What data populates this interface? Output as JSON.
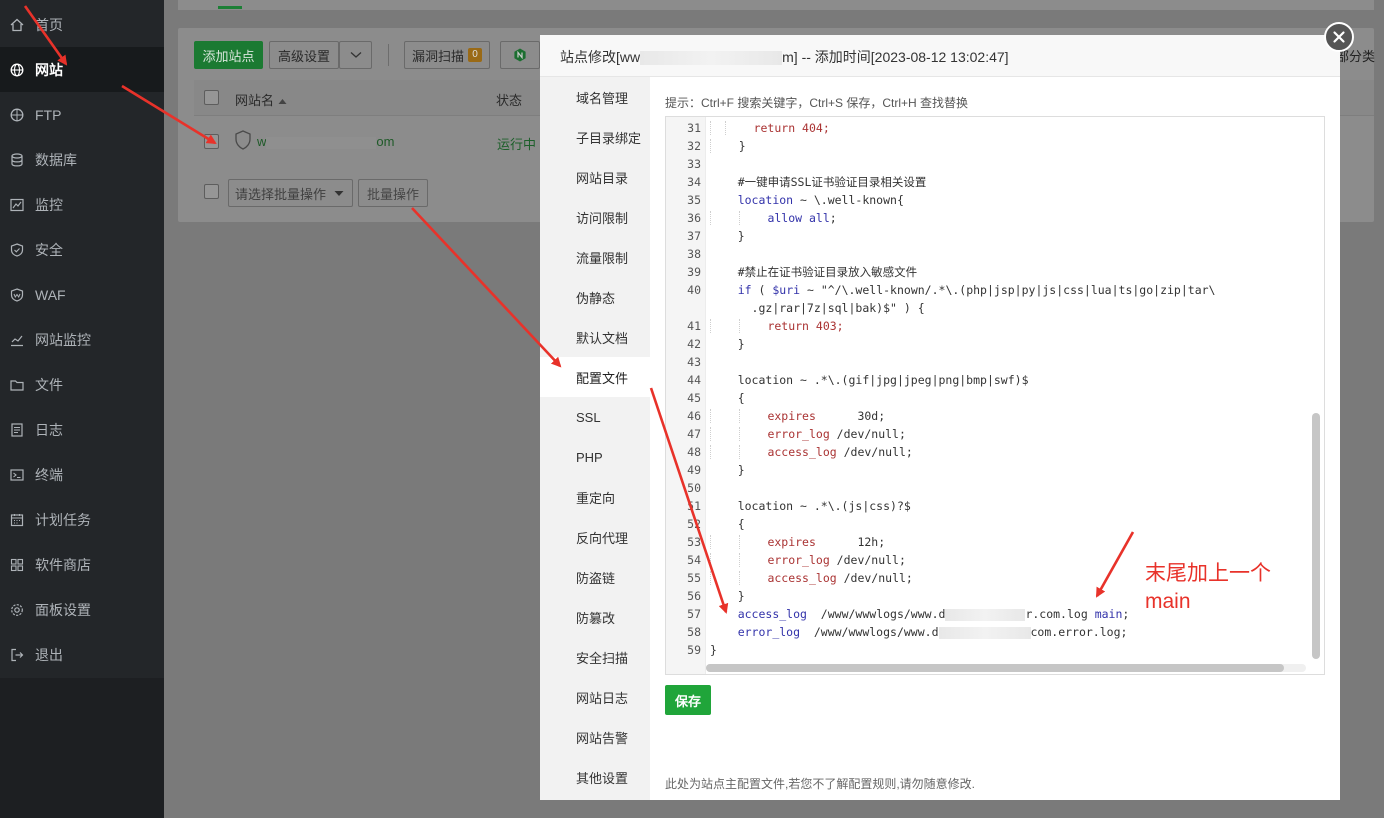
{
  "sidebar": {
    "items": [
      {
        "label": "首页",
        "icon": "home-icon"
      },
      {
        "label": "网站",
        "icon": "globe-icon",
        "active": true
      },
      {
        "label": "FTP",
        "icon": "ftp-icon"
      },
      {
        "label": "数据库",
        "icon": "database-icon"
      },
      {
        "label": "监控",
        "icon": "monitor-icon"
      },
      {
        "label": "安全",
        "icon": "shield-icon"
      },
      {
        "label": "WAF",
        "icon": "waf-icon"
      },
      {
        "label": "网站监控",
        "icon": "chart-icon"
      },
      {
        "label": "文件",
        "icon": "folder-icon"
      },
      {
        "label": "日志",
        "icon": "log-icon"
      },
      {
        "label": "终端",
        "icon": "terminal-icon"
      },
      {
        "label": "计划任务",
        "icon": "calendar-icon"
      },
      {
        "label": "软件商店",
        "icon": "apps-icon"
      },
      {
        "label": "面板设置",
        "icon": "gear-icon"
      },
      {
        "label": "退出",
        "icon": "logout-icon"
      }
    ]
  },
  "toolbar": {
    "add_site": "添加站点",
    "advanced": "高级设置",
    "vuln_scan": "漏洞扫描",
    "vuln_count": "0",
    "right_partial": "部分类"
  },
  "table": {
    "col_site": "网站名",
    "col_status": "状态",
    "row_site_prefix": "w",
    "row_site_suffix": "om",
    "row_status": "运行中",
    "batch_placeholder": "请选择批量操作",
    "batch_button": "批量操作"
  },
  "modal": {
    "title_prefix": "站点修改[ww",
    "title_suffix": "m] -- 添加时间[2023-08-12 13:02:47]",
    "tabs": [
      "域名管理",
      "子目录绑定",
      "网站目录",
      "访问限制",
      "流量限制",
      "伪静态",
      "默认文档",
      "配置文件",
      "SSL",
      "PHP",
      "重定向",
      "反向代理",
      "防盗链",
      "防篡改",
      "安全扫描",
      "网站日志",
      "网站告警",
      "其他设置"
    ],
    "active_tab": "配置文件",
    "hint": "提示：Ctrl+F 搜索关键字，Ctrl+S 保存，Ctrl+H 查找替换",
    "save": "保存",
    "footnote": "此处为站点主配置文件,若您不了解配置规则,请勿随意修改."
  },
  "code": {
    "line_numbers": [
      "31",
      "32",
      "33",
      "34",
      "35",
      "36",
      "37",
      "38",
      "39",
      "40",
      "",
      "41",
      "42",
      "43",
      "44",
      "45",
      "46",
      "47",
      "48",
      "49",
      "50",
      "51",
      "52",
      "53",
      "54",
      "55",
      "56",
      "57",
      "58",
      "59"
    ],
    "l31": "return 404;",
    "l32": "}",
    "l34": "#一键申请SSL证书验证目录相关设置",
    "l35a": "location",
    "l35b": " ~ \\.well-known{",
    "l36a": "allow all",
    "l36b": ";",
    "l37": "}",
    "l39": "#禁止在证书验证目录放入敏感文件",
    "l40a": "if",
    "l40b": " ( ",
    "l40c": "$uri",
    "l40d": " ~ \"^/\\.well-known/.*\\.(php|jsp|py|js|css|lua|ts|go|zip|tar\\",
    "l40e": ".gz|rar|7z|sql|bak)$\" ) {",
    "l41": "return 403;",
    "l42": "}",
    "l44": "location ~ .*\\.(gif|jpg|jpeg|png|bmp|swf)$",
    "l45": "{",
    "l46a": "expires",
    "l46b": "      30d;",
    "l47a": "error_log",
    "l47b": " /dev/null;",
    "l48a": "access_log",
    "l48b": " /dev/null;",
    "l49": "}",
    "l51": "location ~ .*\\.(js|css)?$",
    "l52": "{",
    "l53a": "expires",
    "l53b": "      12h;",
    "l54a": "error_log",
    "l54b": " /dev/null;",
    "l55a": "access_log",
    "l55b": " /dev/null;",
    "l56": "}",
    "l57a": "access_log",
    "l57b": "  /www/wwwlogs/www.d",
    "l57c": "r.com.log ",
    "l57d": "main",
    "l57e": ";",
    "l58a": "error_log",
    "l58b": "  /www/wwwlogs/www.d",
    "l58c": "com.error.log;",
    "l59": "}"
  },
  "annotation": {
    "line1": "末尾加上一个",
    "line2": "main"
  },
  "colors": {
    "accent_green": "#20a53a",
    "annotation_red": "#e8322a",
    "sidebar_bg": "#232629"
  }
}
